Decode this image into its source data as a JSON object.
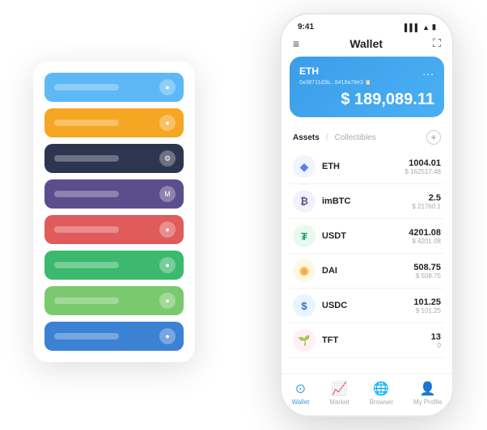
{
  "scene": {
    "bg_card": {
      "bars": [
        {
          "color_class": "bar-blue",
          "icon": "●"
        },
        {
          "color_class": "bar-orange",
          "icon": "●"
        },
        {
          "color_class": "bar-dark",
          "icon": "⚙"
        },
        {
          "color_class": "bar-purple",
          "icon": "M"
        },
        {
          "color_class": "bar-red",
          "icon": "●"
        },
        {
          "color_class": "bar-green",
          "icon": "●"
        },
        {
          "color_class": "bar-light-green",
          "icon": "●"
        },
        {
          "color_class": "bar-blue2",
          "icon": "●"
        }
      ]
    },
    "phone": {
      "status_bar": {
        "time": "9:41",
        "signal": "▌▌▌",
        "wifi": "▲",
        "battery": "▮"
      },
      "header": {
        "menu_icon": "≡",
        "title": "Wallet",
        "expand_icon": "⛶"
      },
      "eth_card": {
        "label": "ETH",
        "dots": "...",
        "address": "0x08711d3b...8418a78e3 📋",
        "balance": "$ 189,089.11"
      },
      "assets_section": {
        "tab_active": "Assets",
        "divider": "/",
        "tab_inactive": "Collectibles",
        "add_label": "+"
      },
      "assets": [
        {
          "name": "ETH",
          "icon_char": "◆",
          "icon_color": "#627eea",
          "icon_bg": "#f0f4ff",
          "amount": "1004.01",
          "usd": "$ 162517.48"
        },
        {
          "name": "imBTC",
          "icon_char": "₿",
          "icon_color": "#5b4e8c",
          "icon_bg": "#f5f0ff",
          "amount": "2.5",
          "usd": "$ 21760.1"
        },
        {
          "name": "USDT",
          "icon_char": "₮",
          "icon_color": "#26a17b",
          "icon_bg": "#e8f9f0",
          "amount": "4201.08",
          "usd": "$ 4201.08"
        },
        {
          "name": "DAI",
          "icon_char": "◉",
          "icon_color": "#f5ac37",
          "icon_bg": "#fff8e0",
          "amount": "508.75",
          "usd": "$ 508.75"
        },
        {
          "name": "USDC",
          "icon_char": "$",
          "icon_color": "#2775ca",
          "icon_bg": "#e8f4ff",
          "amount": "101.25",
          "usd": "$ 101.25"
        },
        {
          "name": "TFT",
          "icon_char": "🌱",
          "icon_color": "#e05c5c",
          "icon_bg": "#fff0f5",
          "amount": "13",
          "usd": "0"
        }
      ],
      "bottom_nav": [
        {
          "label": "Wallet",
          "icon": "⊙",
          "active": true
        },
        {
          "label": "Market",
          "icon": "📊",
          "active": false
        },
        {
          "label": "Browser",
          "icon": "👤",
          "active": false
        },
        {
          "label": "My Profile",
          "icon": "👤",
          "active": false
        }
      ]
    }
  }
}
